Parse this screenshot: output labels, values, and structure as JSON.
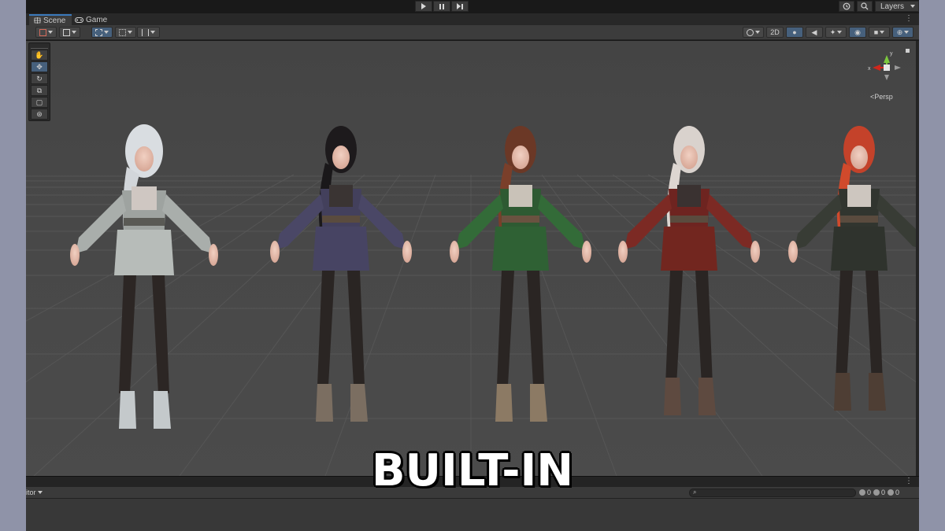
{
  "tabs": {
    "scene": "Scene",
    "game": "Game",
    "menu": "⋮"
  },
  "top": {
    "layers": "Layers",
    "history_icon": "history-icon",
    "search_icon": "search-icon"
  },
  "scene_toolbar": {
    "mode_2d": "2D"
  },
  "viewport": {
    "projection": "Persp",
    "gizmo_x": "x",
    "gizmo_y": "y"
  },
  "caption": "BUILT-IN",
  "console": {
    "tab": "itor",
    "errors": "0",
    "warnings": "0",
    "logs": "0",
    "menu": "⋮"
  },
  "colors": {
    "accent": "#3a79bb",
    "selected": "#46607c",
    "x_axis": "#d0271c",
    "y_axis": "#7cc83d"
  }
}
